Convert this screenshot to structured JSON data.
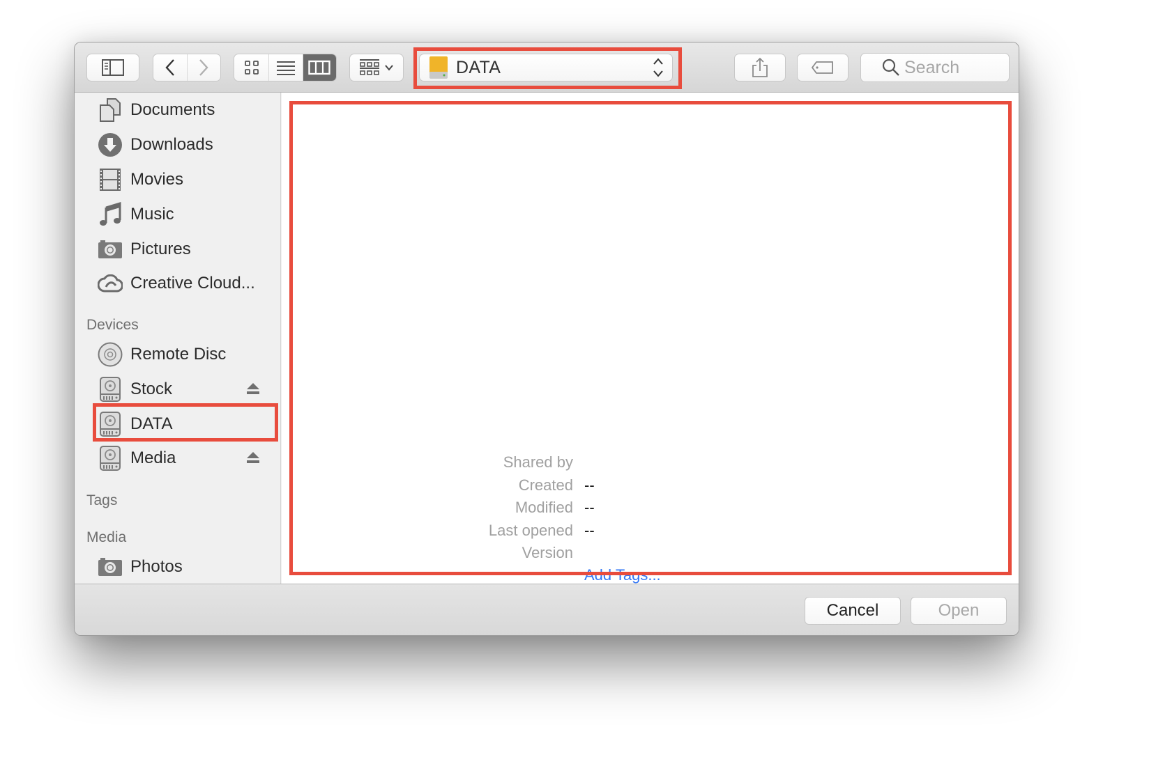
{
  "toolbar": {
    "path_popup_label": "DATA",
    "search_placeholder": "Search",
    "view_modes": [
      "icon-view",
      "list-view",
      "column-view"
    ],
    "active_view_mode": "column-view"
  },
  "sidebar": {
    "favorites": [
      {
        "label": "Documents",
        "icon": "documents-icon"
      },
      {
        "label": "Downloads",
        "icon": "downloads-icon"
      },
      {
        "label": "Movies",
        "icon": "movies-icon"
      },
      {
        "label": "Music",
        "icon": "music-icon"
      },
      {
        "label": "Pictures",
        "icon": "pictures-icon"
      },
      {
        "label": "Creative Cloud...",
        "icon": "creative-cloud-icon"
      }
    ],
    "devices_heading": "Devices",
    "devices": [
      {
        "label": "Remote Disc",
        "icon": "disc-icon",
        "ejectable": false
      },
      {
        "label": "Stock",
        "icon": "hard-drive-icon",
        "ejectable": true
      },
      {
        "label": "DATA",
        "icon": "hard-drive-icon",
        "ejectable": false,
        "selected": true
      },
      {
        "label": "Media",
        "icon": "hard-drive-icon",
        "ejectable": true
      }
    ],
    "tags_heading": "Tags",
    "media_heading": "Media",
    "media": [
      {
        "label": "Photos",
        "icon": "photos-icon"
      }
    ]
  },
  "preview": {
    "shared_by_label": "Shared by",
    "created_label": "Created",
    "created_value": "--",
    "modified_label": "Modified",
    "modified_value": "--",
    "last_opened_label": "Last opened",
    "last_opened_value": "--",
    "version_label": "Version",
    "add_tags_link": "Add Tags..."
  },
  "footer": {
    "cancel_label": "Cancel",
    "open_label": "Open",
    "open_enabled": false
  },
  "colors": {
    "highlight": "#e84c3d",
    "link": "#3478f6",
    "drive_icon": "#f0b429"
  }
}
